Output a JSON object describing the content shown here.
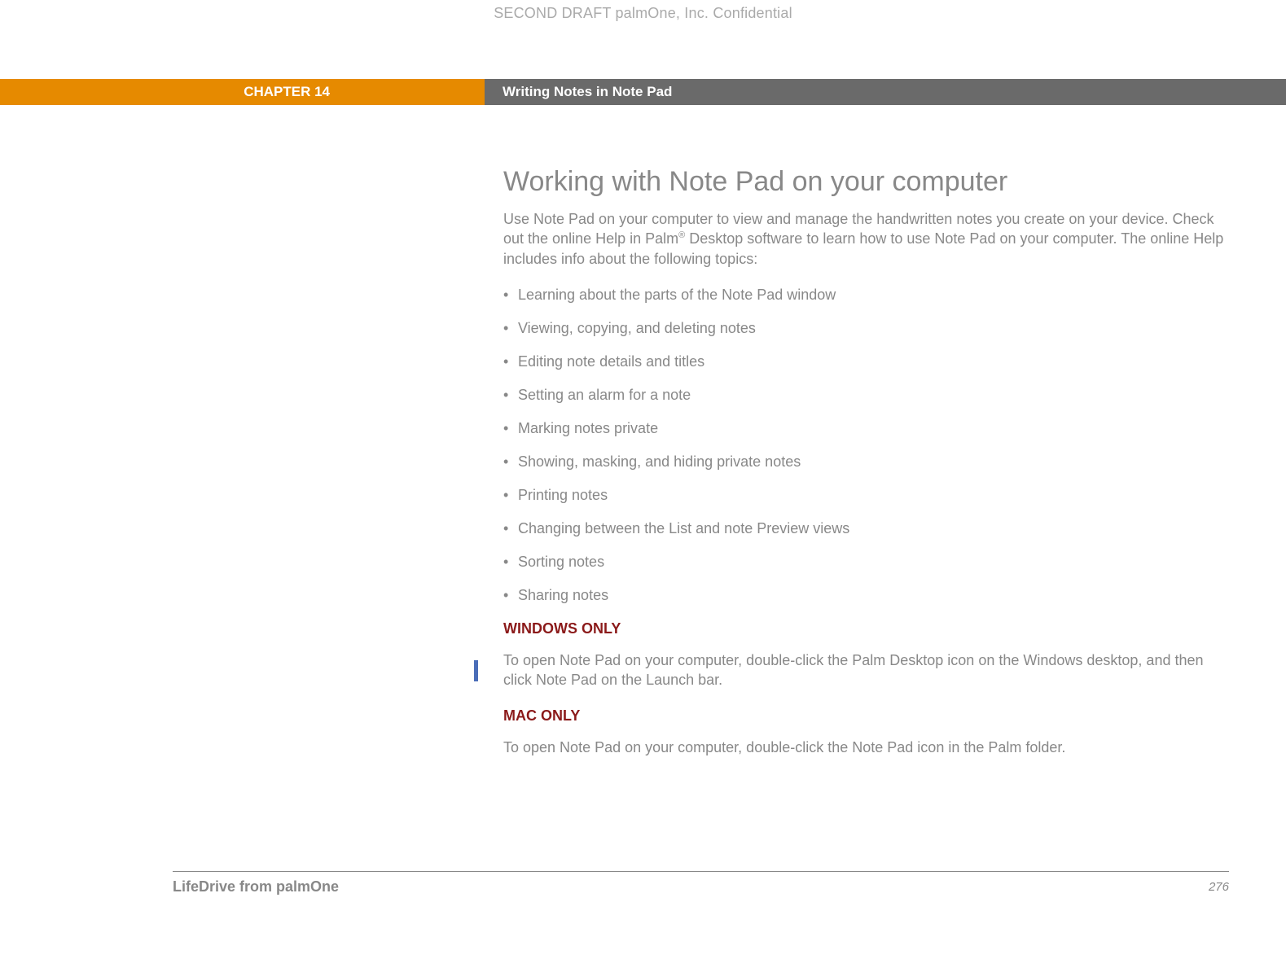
{
  "draftHeader": "SECOND DRAFT palmOne, Inc.  Confidential",
  "chapterLabel": "CHAPTER 14",
  "chapterTitle": "Writing Notes in Note Pad",
  "heading": "Working with Note Pad on your computer",
  "introPart1": "Use Note Pad on your computer to view and manage the handwritten notes you create on your device. Check out the online Help in Palm",
  "introReg": "®",
  "introPart2": " Desktop software to learn how to use Note Pad on your computer. The online Help includes info about the following topics:",
  "bullets": [
    "Learning about the parts of the Note Pad window",
    "Viewing, copying, and deleting notes",
    "Editing note details and titles",
    "Setting an alarm for a note",
    "Marking notes private",
    "Showing, masking, and hiding private notes",
    "Printing notes",
    "Changing between the List and note Preview views",
    "Sorting notes",
    "Sharing notes"
  ],
  "windowsLabel": "WINDOWS ONLY",
  "windowsText": "To open Note Pad on your computer, double-click the Palm Desktop icon on the Windows desktop, and then click Note Pad on the Launch bar.",
  "macLabel": "MAC ONLY",
  "macText": "To open Note Pad on your computer, double-click the Note Pad icon in the Palm folder.",
  "footerLeft": "LifeDrive from palmOne",
  "footerRight": "276"
}
